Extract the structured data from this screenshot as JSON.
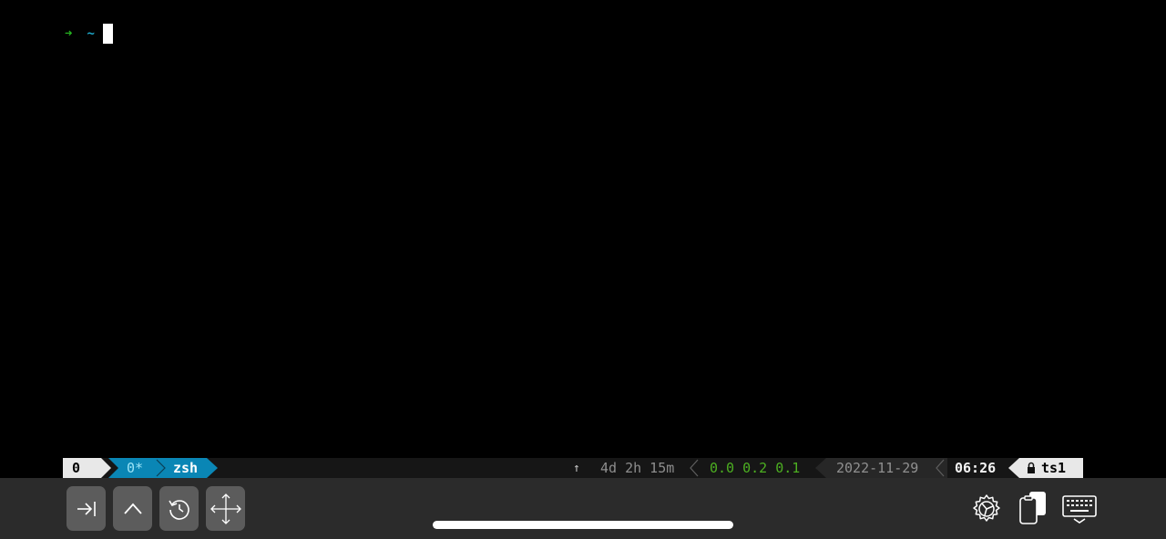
{
  "terminal": {
    "prompt_arrow": "➜",
    "prompt_dir": "~"
  },
  "status_bar": {
    "session": "0",
    "window_inactive": "0*",
    "window_separator": "〉",
    "window_active": "zsh",
    "uptime_arrow": "↑",
    "uptime": "4d 2h 15m",
    "load": "0.0 0.2 0.1",
    "date": "2022-11-29",
    "time": "06:26",
    "host": "ts1",
    "colors": {
      "session_bg": "#e8e8e8",
      "window_bg": "#0a86b5",
      "load_text": "#4caf21",
      "host_bg": "#e8e8e8"
    }
  },
  "toolbar": {
    "keys": [
      {
        "icon": "tab-icon"
      },
      {
        "icon": "caret-up-icon"
      },
      {
        "icon": "history-icon"
      },
      {
        "icon": "move-icon"
      }
    ],
    "right_icons": [
      "settings-icon",
      "clipboard-icon",
      "keyboard-icon"
    ]
  }
}
